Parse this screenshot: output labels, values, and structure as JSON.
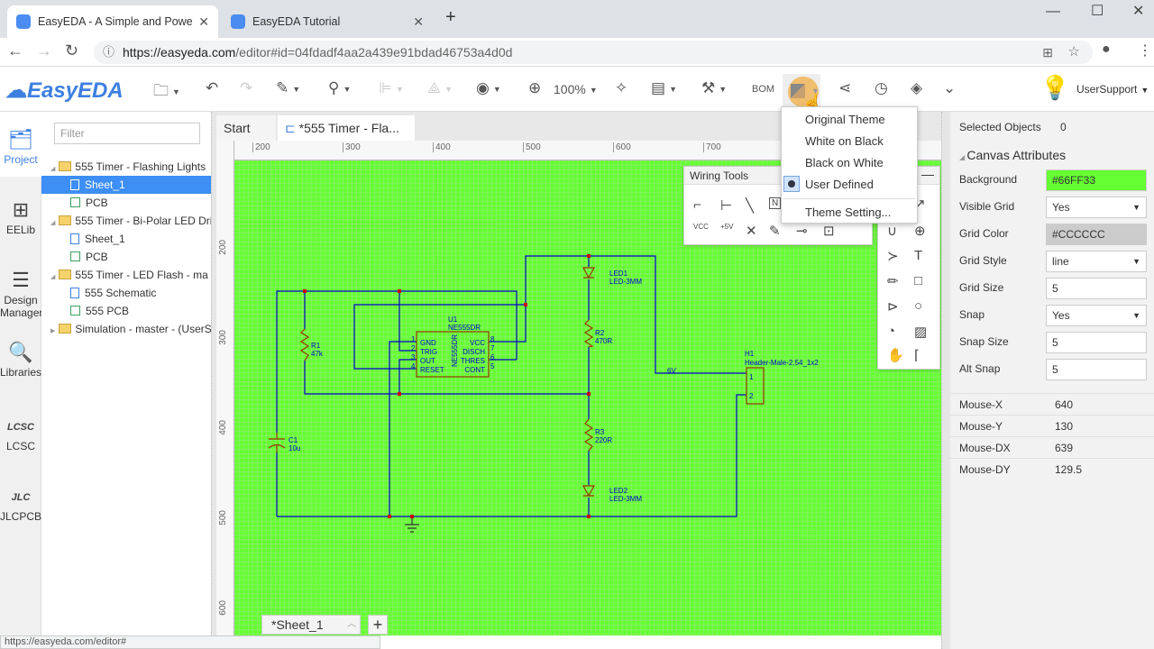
{
  "browser": {
    "tabs": [
      {
        "title": "EasyEDA - A Simple and Powe",
        "active": true
      },
      {
        "title": "EasyEDA Tutorial",
        "active": false
      }
    ],
    "url_host": "https://easyeda.com",
    "url_path": "/editor#id=04fdadf4aa2a439e91bdad46753a4d0d",
    "status_url": "https://easyeda.com/editor#"
  },
  "toolbar": {
    "logo": "EasyEDA",
    "zoom": "100%",
    "bom": "BOM",
    "user": "UserSupport"
  },
  "leftnav": [
    {
      "label": "Project"
    },
    {
      "label": "EELib"
    },
    {
      "label": "Design Manager"
    },
    {
      "label": "Libraries"
    },
    {
      "label": "LCSC"
    },
    {
      "label": "JLCPCB"
    }
  ],
  "tree": {
    "filter_placeholder": "Filter",
    "items": [
      {
        "label": "555 Timer - Flashing Lights",
        "type": "folder"
      },
      {
        "label": "Sheet_1",
        "type": "schematic",
        "selected": true
      },
      {
        "label": "PCB",
        "type": "pcb"
      },
      {
        "label": "555 Timer - Bi-Polar LED Dri",
        "type": "folder"
      },
      {
        "label": "Sheet_1",
        "type": "schematic"
      },
      {
        "label": "PCB",
        "type": "pcb"
      },
      {
        "label": "555 Timer - LED Flash - ma",
        "type": "folder"
      },
      {
        "label": "555 Schematic",
        "type": "schematic"
      },
      {
        "label": "555 PCB",
        "type": "pcb"
      },
      {
        "label": "Simulation - master - (UserS",
        "type": "folder"
      }
    ]
  },
  "doc_tabs": [
    {
      "label": "Start"
    },
    {
      "label": "*555 Timer - Fla..."
    }
  ],
  "ruler": {
    "top": [
      "200",
      "300",
      "400",
      "500",
      "600",
      "700"
    ],
    "left": [
      "200",
      "300",
      "400",
      "500",
      "600"
    ]
  },
  "theme_menu": {
    "items": [
      "Original Theme",
      "White on Black",
      "Black on White",
      "User Defined"
    ],
    "selected": "User Defined",
    "setting": "Theme Setting..."
  },
  "wiring_tools": {
    "title": "Wiring Tools",
    "vcc": "VCC",
    "plus5v": "+5V"
  },
  "schematic": {
    "u1_ref": "U1",
    "u1_val": "NE555DR",
    "u1_body": "NE555DR",
    "pins_left": [
      [
        "1",
        "GND"
      ],
      [
        "2",
        "TRIG"
      ],
      [
        "3",
        "OUT"
      ],
      [
        "4",
        "RESET"
      ]
    ],
    "pins_right": [
      [
        "8",
        "VCC"
      ],
      [
        "7",
        "DISCH"
      ],
      [
        "6",
        "THRES"
      ],
      [
        "5",
        "CONT"
      ]
    ],
    "r1": [
      "R1",
      "47k"
    ],
    "r2": [
      "R2",
      "470R"
    ],
    "r3": [
      "R3",
      "220R"
    ],
    "c1": [
      "C1",
      "10u"
    ],
    "led1": [
      "LED1",
      "LED-3MM"
    ],
    "led2": [
      "LED2",
      "LED-3MM"
    ],
    "h1": [
      "H1",
      "Header-Male-2.54_1x2"
    ],
    "h1_pins": [
      "1",
      "2"
    ],
    "net_6v": "6V",
    "wire_color": "#0000CC",
    "junction_color": "#CC0000"
  },
  "sheet_tab": "*Sheet_1",
  "properties": {
    "selected_label": "Selected Objects",
    "selected_count": "0",
    "section": "Canvas Attributes",
    "rows": [
      {
        "label": "Background",
        "value": "#66FF33"
      },
      {
        "label": "Visible Grid",
        "value": "Yes",
        "dropdown": true
      },
      {
        "label": "Grid Color",
        "value": "#CCCCCC"
      },
      {
        "label": "Grid Style",
        "value": "line",
        "dropdown": true
      },
      {
        "label": "Grid Size",
        "value": "5"
      },
      {
        "label": "Snap",
        "value": "Yes",
        "dropdown": true
      },
      {
        "label": "Snap Size",
        "value": "5"
      },
      {
        "label": "Alt Snap",
        "value": "5"
      }
    ],
    "mouse": [
      {
        "label": "Mouse-X",
        "value": "640"
      },
      {
        "label": "Mouse-Y",
        "value": "130"
      },
      {
        "label": "Mouse-DX",
        "value": "639"
      },
      {
        "label": "Mouse-DY",
        "value": "129.5"
      }
    ]
  },
  "colors": {
    "accent": "#3d8ef5",
    "canvas_bg": "#66FF33",
    "grid": "#CCCCCC"
  }
}
